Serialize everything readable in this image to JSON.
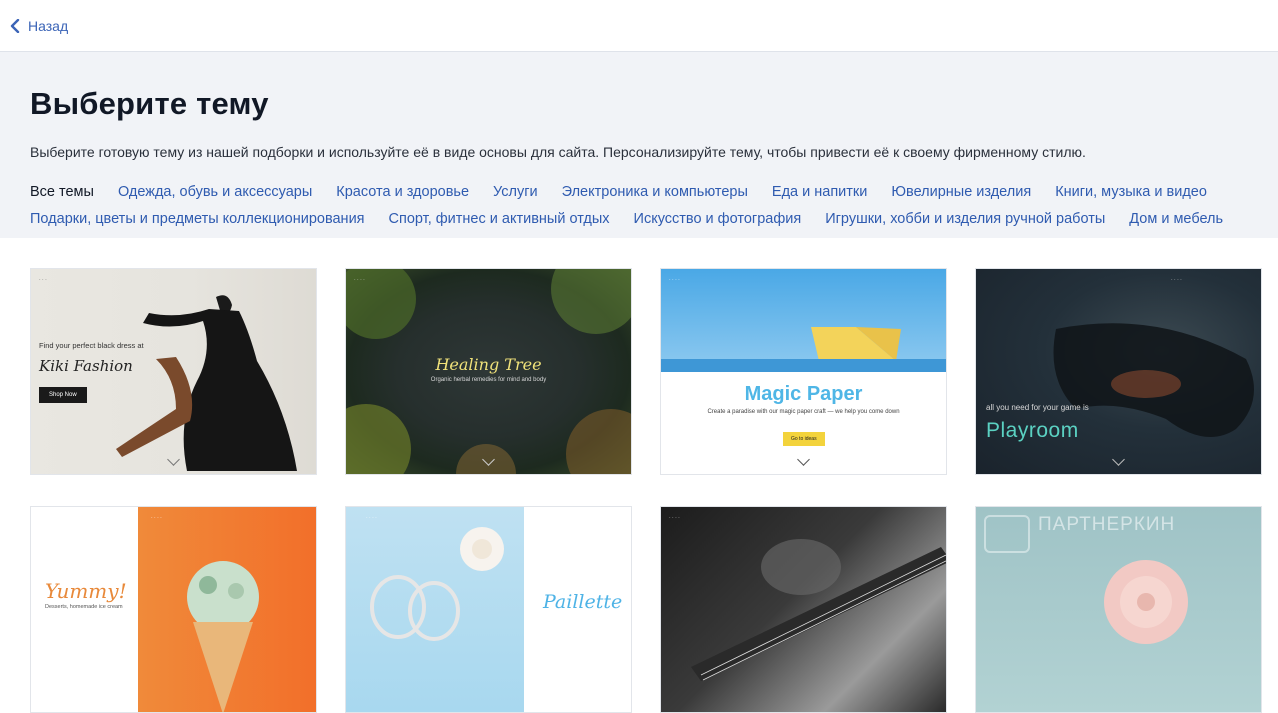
{
  "topbar": {
    "back_label": "Назад"
  },
  "hero": {
    "title": "Выберите тему",
    "description": "Выберите готовую тему из нашей подборки и используйте её в виде основы для сайта. Персонализируйте тему, чтобы привести её к своему фирменному стилю."
  },
  "categories": [
    "Все темы",
    "Одежда, обувь и аксессуары",
    "Красота и здоровье",
    "Услуги",
    "Электроника и компьютеры",
    "Еда и напитки",
    "Ювелирные изделия",
    "Книги, музыка и видео",
    "Подарки, цветы и предметы коллекционирования",
    "Спорт, фитнес и активный отдых",
    "Искусство и фотография",
    "Игрушки, хобби и изделия ручной работы",
    "Дом и мебель"
  ],
  "active_category": "Все темы",
  "themes": [
    {
      "name": "Kiki Fashion",
      "tagline": "Find your perfect black dress at",
      "button": "Shop Now"
    },
    {
      "name": "Healing Tree",
      "tagline": "Organic herbal remedies for mind and body"
    },
    {
      "name": "Magic Paper",
      "tagline": "Create a paradise with our magic paper craft — we help you come down",
      "button": "Go to ideas"
    },
    {
      "name": "Playroom",
      "tagline": "all you need for your game is"
    },
    {
      "name": "Yummy!",
      "tagline": "Desserts, homemade ice cream"
    },
    {
      "name": "Paillette"
    },
    {
      "name": ""
    },
    {
      "name": ""
    }
  ],
  "watermark": "ПАРТНЕРКИН",
  "colors": {
    "link": "#2f5bb0",
    "hero_bg": "#f1f3f7",
    "title": "#111826"
  }
}
